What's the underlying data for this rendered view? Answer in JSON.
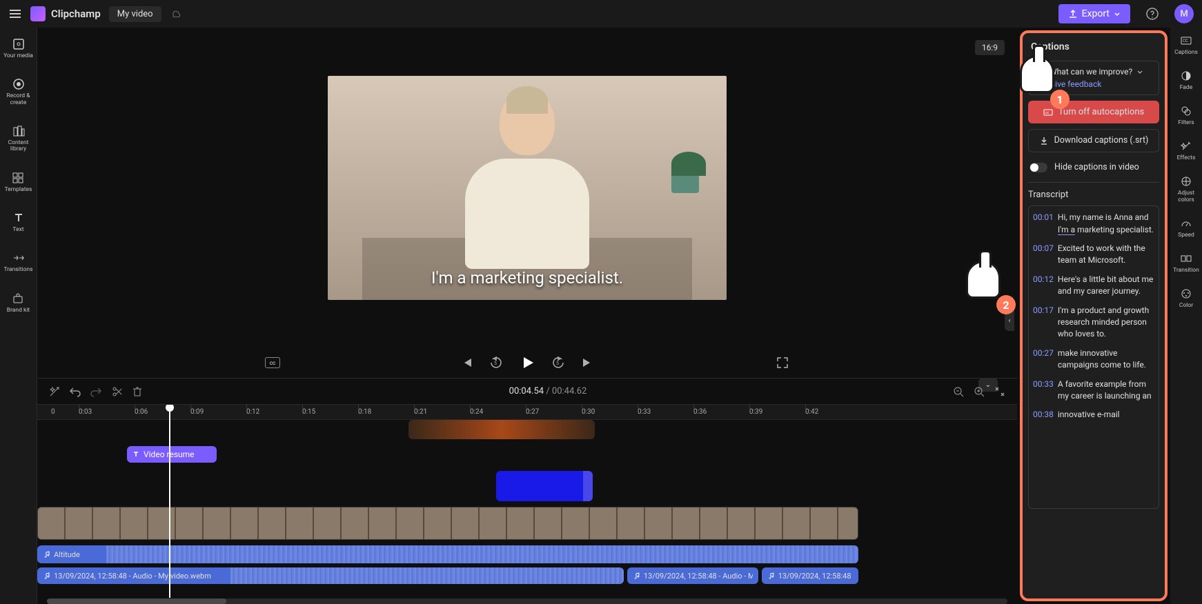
{
  "app": {
    "brand": "Clipchamp",
    "video_title": "My video",
    "avatar_initial": "M"
  },
  "topbar": {
    "export_label": "Export",
    "aspect_ratio": "16:9"
  },
  "left_rail": [
    {
      "label": "Your media"
    },
    {
      "label": "Record & create"
    },
    {
      "label": "Content library"
    },
    {
      "label": "Templates"
    },
    {
      "label": "Text"
    },
    {
      "label": "Transitions"
    },
    {
      "label": "Brand kit"
    }
  ],
  "right_rail": [
    {
      "label": "Captions"
    },
    {
      "label": "Fade"
    },
    {
      "label": "Filters"
    },
    {
      "label": "Effects"
    },
    {
      "label": "Adjust colors"
    },
    {
      "label": "Speed"
    },
    {
      "label": "Transition"
    },
    {
      "label": "Color"
    }
  ],
  "preview": {
    "caption_text": "I'm a marketing specialist."
  },
  "playback": {
    "current_time": "00:04.54",
    "duration": "00:44.62"
  },
  "captions_panel": {
    "title": "Captions",
    "improve_prompt": "What can we improve?",
    "feedback_link": "Give feedback",
    "turn_off": "Turn off autocaptions",
    "download": "Download captions (.srt)",
    "hide_label": "Hide captions in video",
    "transcript_title": "Transcript",
    "transcript": [
      {
        "t": "00:01",
        "text_prefix": "Hi, my name is Anna and ",
        "text_hl": "I'm a",
        "text_suffix": " marketing specialist."
      },
      {
        "t": "00:07",
        "text": "Excited to work with the team at Microsoft."
      },
      {
        "t": "00:12",
        "text": "Here's a little bit about me and my career journey."
      },
      {
        "t": "00:17",
        "text": "I'm a product and growth research minded person who loves to."
      },
      {
        "t": "00:27",
        "text": "make innovative campaigns come to life."
      },
      {
        "t": "00:33",
        "text": "A favorite example from my career is launching an"
      },
      {
        "t": "00:38",
        "text": "innovative e-mail"
      }
    ]
  },
  "ruler_ticks": [
    "0:03",
    "0:06",
    "0:09",
    "0:12",
    "0:15",
    "0:18",
    "0:21",
    "0:24",
    "0:27",
    "0:30",
    "0:33",
    "0:36",
    "0:39",
    "0:42"
  ],
  "ruler_zero": "0",
  "tracks": {
    "text_clip": "Video resume",
    "audio1_name": "Altitude",
    "audio2_name": "13/09/2024, 12:58:48 - Audio - My video.webm",
    "audio3_name": "13/09/2024, 12:58:48 - Audio - M",
    "audio4_name": "13/09/2024, 12:58:48 -"
  },
  "step_badges": {
    "one": "1",
    "two": "2"
  }
}
